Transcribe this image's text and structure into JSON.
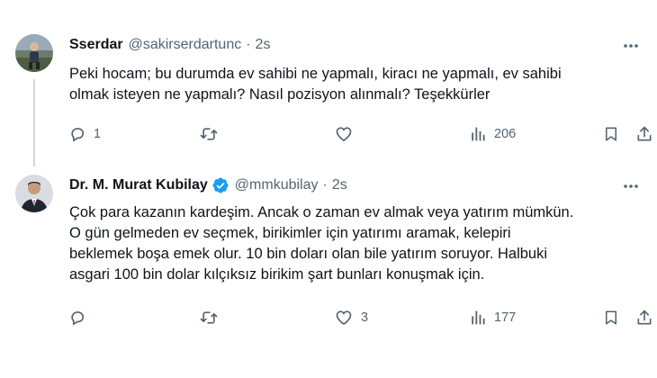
{
  "tweets": [
    {
      "display_name": "Sserdar",
      "handle": "@sakirserdartunc",
      "separator": "·",
      "time": "2s",
      "text_lines": [
        "Peki hocam; bu durumda ev sahibi ne yapmalı, kiracı ne yapmalı, ev sahibi",
        "olmak isteyen ne yapmalı? Nasıl pozisyon alınmalı? Teşekkürler"
      ],
      "reply_count": "1",
      "retweet_count": "",
      "like_count": "",
      "view_count": "206"
    },
    {
      "display_name": "Dr. M. Murat Kubilay",
      "verified": true,
      "handle": "@mmkubilay",
      "separator": "·",
      "time": "2s",
      "text_lines": [
        "Çok para kazanın kardeşim. Ancak o zaman ev almak veya yatırım mümkün.",
        "O gün gelmeden ev seçmek, birikimler için yatırımı aramak, kelepiri",
        "beklemek boşa emek olur. 10 bin doları olan bile yatırım soruyor. Halbuki",
        "asgari 100 bin dolar kılçıksız birikim şart bunları konuşmak için."
      ],
      "reply_count": "",
      "retweet_count": "",
      "like_count": "3",
      "view_count": "177"
    }
  ],
  "icons": {
    "more": "more-horizontal-icon",
    "reply": "reply-icon",
    "retweet": "retweet-icon",
    "like": "heart-icon",
    "views": "views-chart-icon",
    "bookmark": "bookmark-icon",
    "share": "share-icon",
    "verified": "verified-badge-icon"
  },
  "colors": {
    "text_primary": "#0f1419",
    "text_secondary": "#536471",
    "verified_blue": "#1d9bf0",
    "divider": "#eff3f4",
    "thread_line": "#cfd9de"
  }
}
